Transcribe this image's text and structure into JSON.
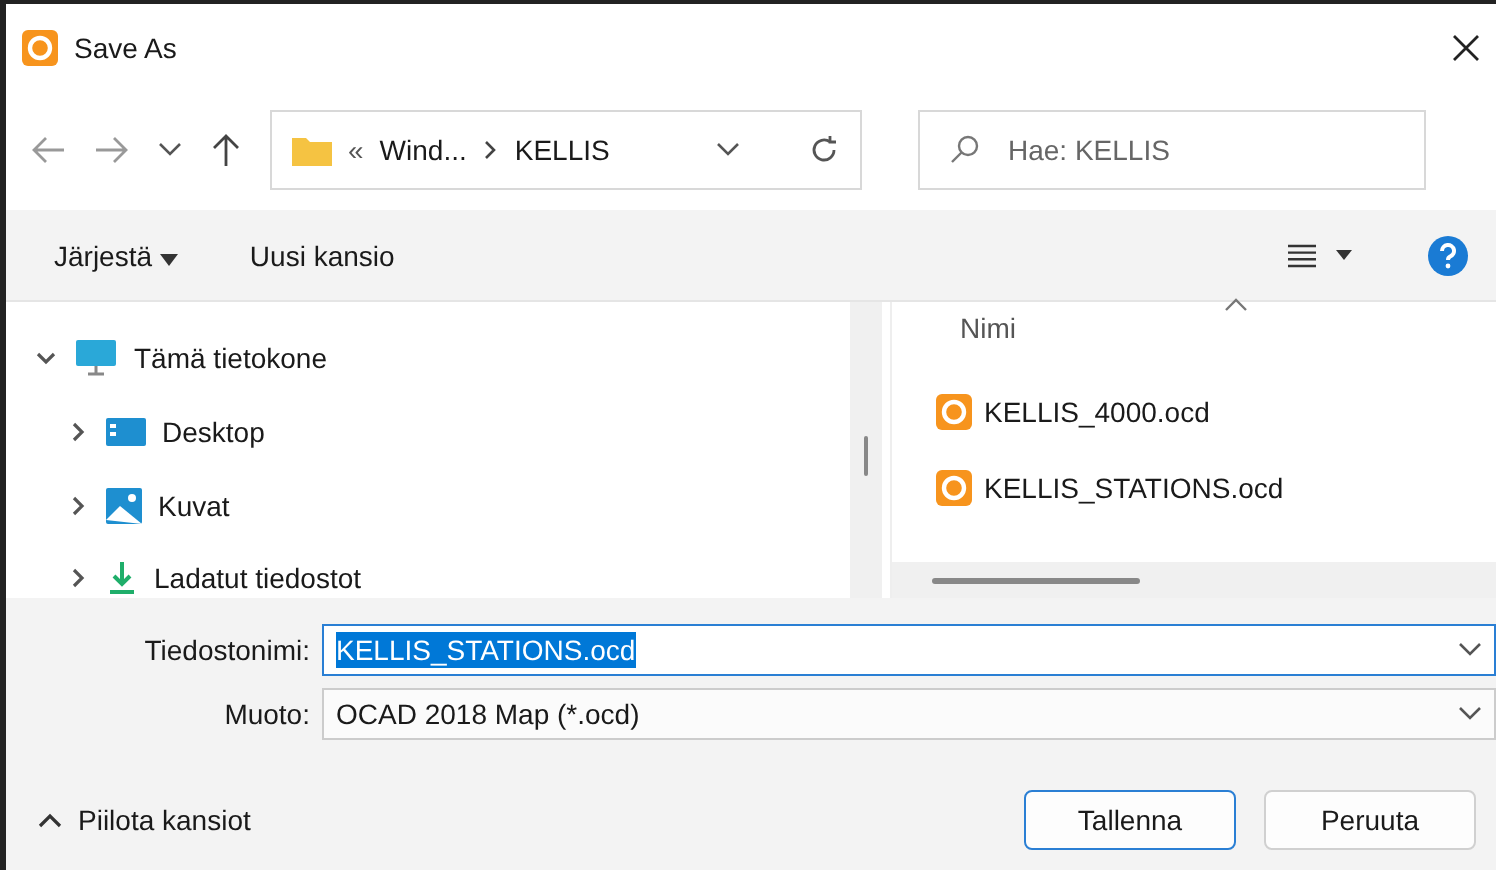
{
  "window": {
    "title": "Save As"
  },
  "breadcrumb": {
    "prefix": "«",
    "items": [
      "Wind...",
      "KELLIS"
    ]
  },
  "search": {
    "placeholder": "Hae: KELLIS"
  },
  "toolbar": {
    "organize": "Järjestä",
    "new_folder": "Uusi kansio"
  },
  "tree": [
    {
      "label": "Tämä tietokone",
      "expanded": true,
      "kind": "computer",
      "children": [
        {
          "label": "Desktop",
          "expanded": false,
          "kind": "desktop"
        },
        {
          "label": "Kuvat",
          "expanded": false,
          "kind": "pictures"
        },
        {
          "label": "Ladatut tiedostot",
          "expanded": false,
          "kind": "downloads"
        }
      ]
    }
  ],
  "files": {
    "column": "Nimi",
    "items": [
      {
        "name": "KELLIS_4000.ocd"
      },
      {
        "name": "KELLIS_STATIONS.ocd"
      }
    ]
  },
  "filename": {
    "label": "Tiedostonimi:",
    "value": "KELLIS_STATIONS.ocd",
    "selected": true
  },
  "format": {
    "label": "Muoto:",
    "value": "OCAD 2018 Map (*.ocd)"
  },
  "hide_folders": "Piilota kansiot",
  "buttons": [
    {
      "label": "Tallenna",
      "default": true
    },
    {
      "label": "Peruuta",
      "default": false
    }
  ]
}
